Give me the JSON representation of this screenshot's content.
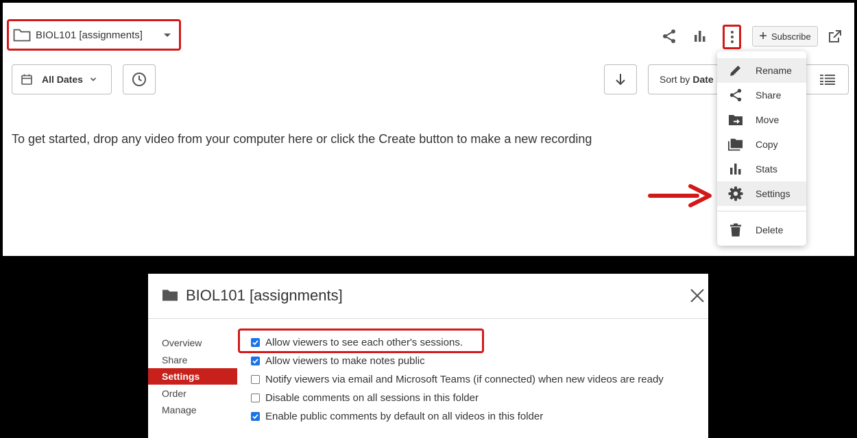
{
  "folder": {
    "name": "BIOL101 [assignments]"
  },
  "toolbar": {
    "subscribe_label": "Subscribe",
    "dates_label": "All Dates",
    "sort_prefix": "Sort by",
    "sort_value": "Date"
  },
  "empty_message": "To get started, drop any video from your computer here or click the Create button to make a new recording",
  "menu": {
    "items": [
      {
        "label": "Rename",
        "icon": "pencil-icon"
      },
      {
        "label": "Share",
        "icon": "share-icon"
      },
      {
        "label": "Move",
        "icon": "folder-move-icon"
      },
      {
        "label": "Copy",
        "icon": "copy-icon"
      },
      {
        "label": "Stats",
        "icon": "stats-icon"
      },
      {
        "label": "Settings",
        "icon": "gear-icon"
      },
      {
        "label": "Delete",
        "icon": "trash-icon"
      }
    ]
  },
  "dialog": {
    "title": "BIOL101 [assignments]",
    "sidebar": [
      "Overview",
      "Share",
      "Settings",
      "Order",
      "Manage"
    ],
    "active_sidebar": "Settings",
    "options": [
      {
        "label": "Allow viewers to see each other's sessions.",
        "checked": true
      },
      {
        "label": "Allow viewers to make notes public",
        "checked": true
      },
      {
        "label": "Notify viewers via email and Microsoft Teams (if connected) when new videos are ready",
        "checked": false
      },
      {
        "label": "Disable comments on all sessions in this folder",
        "checked": false
      },
      {
        "label": "Enable public comments by default on all videos in this folder",
        "checked": true
      }
    ]
  },
  "colors": {
    "annotation_red": "#d21919",
    "active_tab": "#c8201a",
    "checkbox_checked": "#1a73e8",
    "frame": "#000000"
  }
}
